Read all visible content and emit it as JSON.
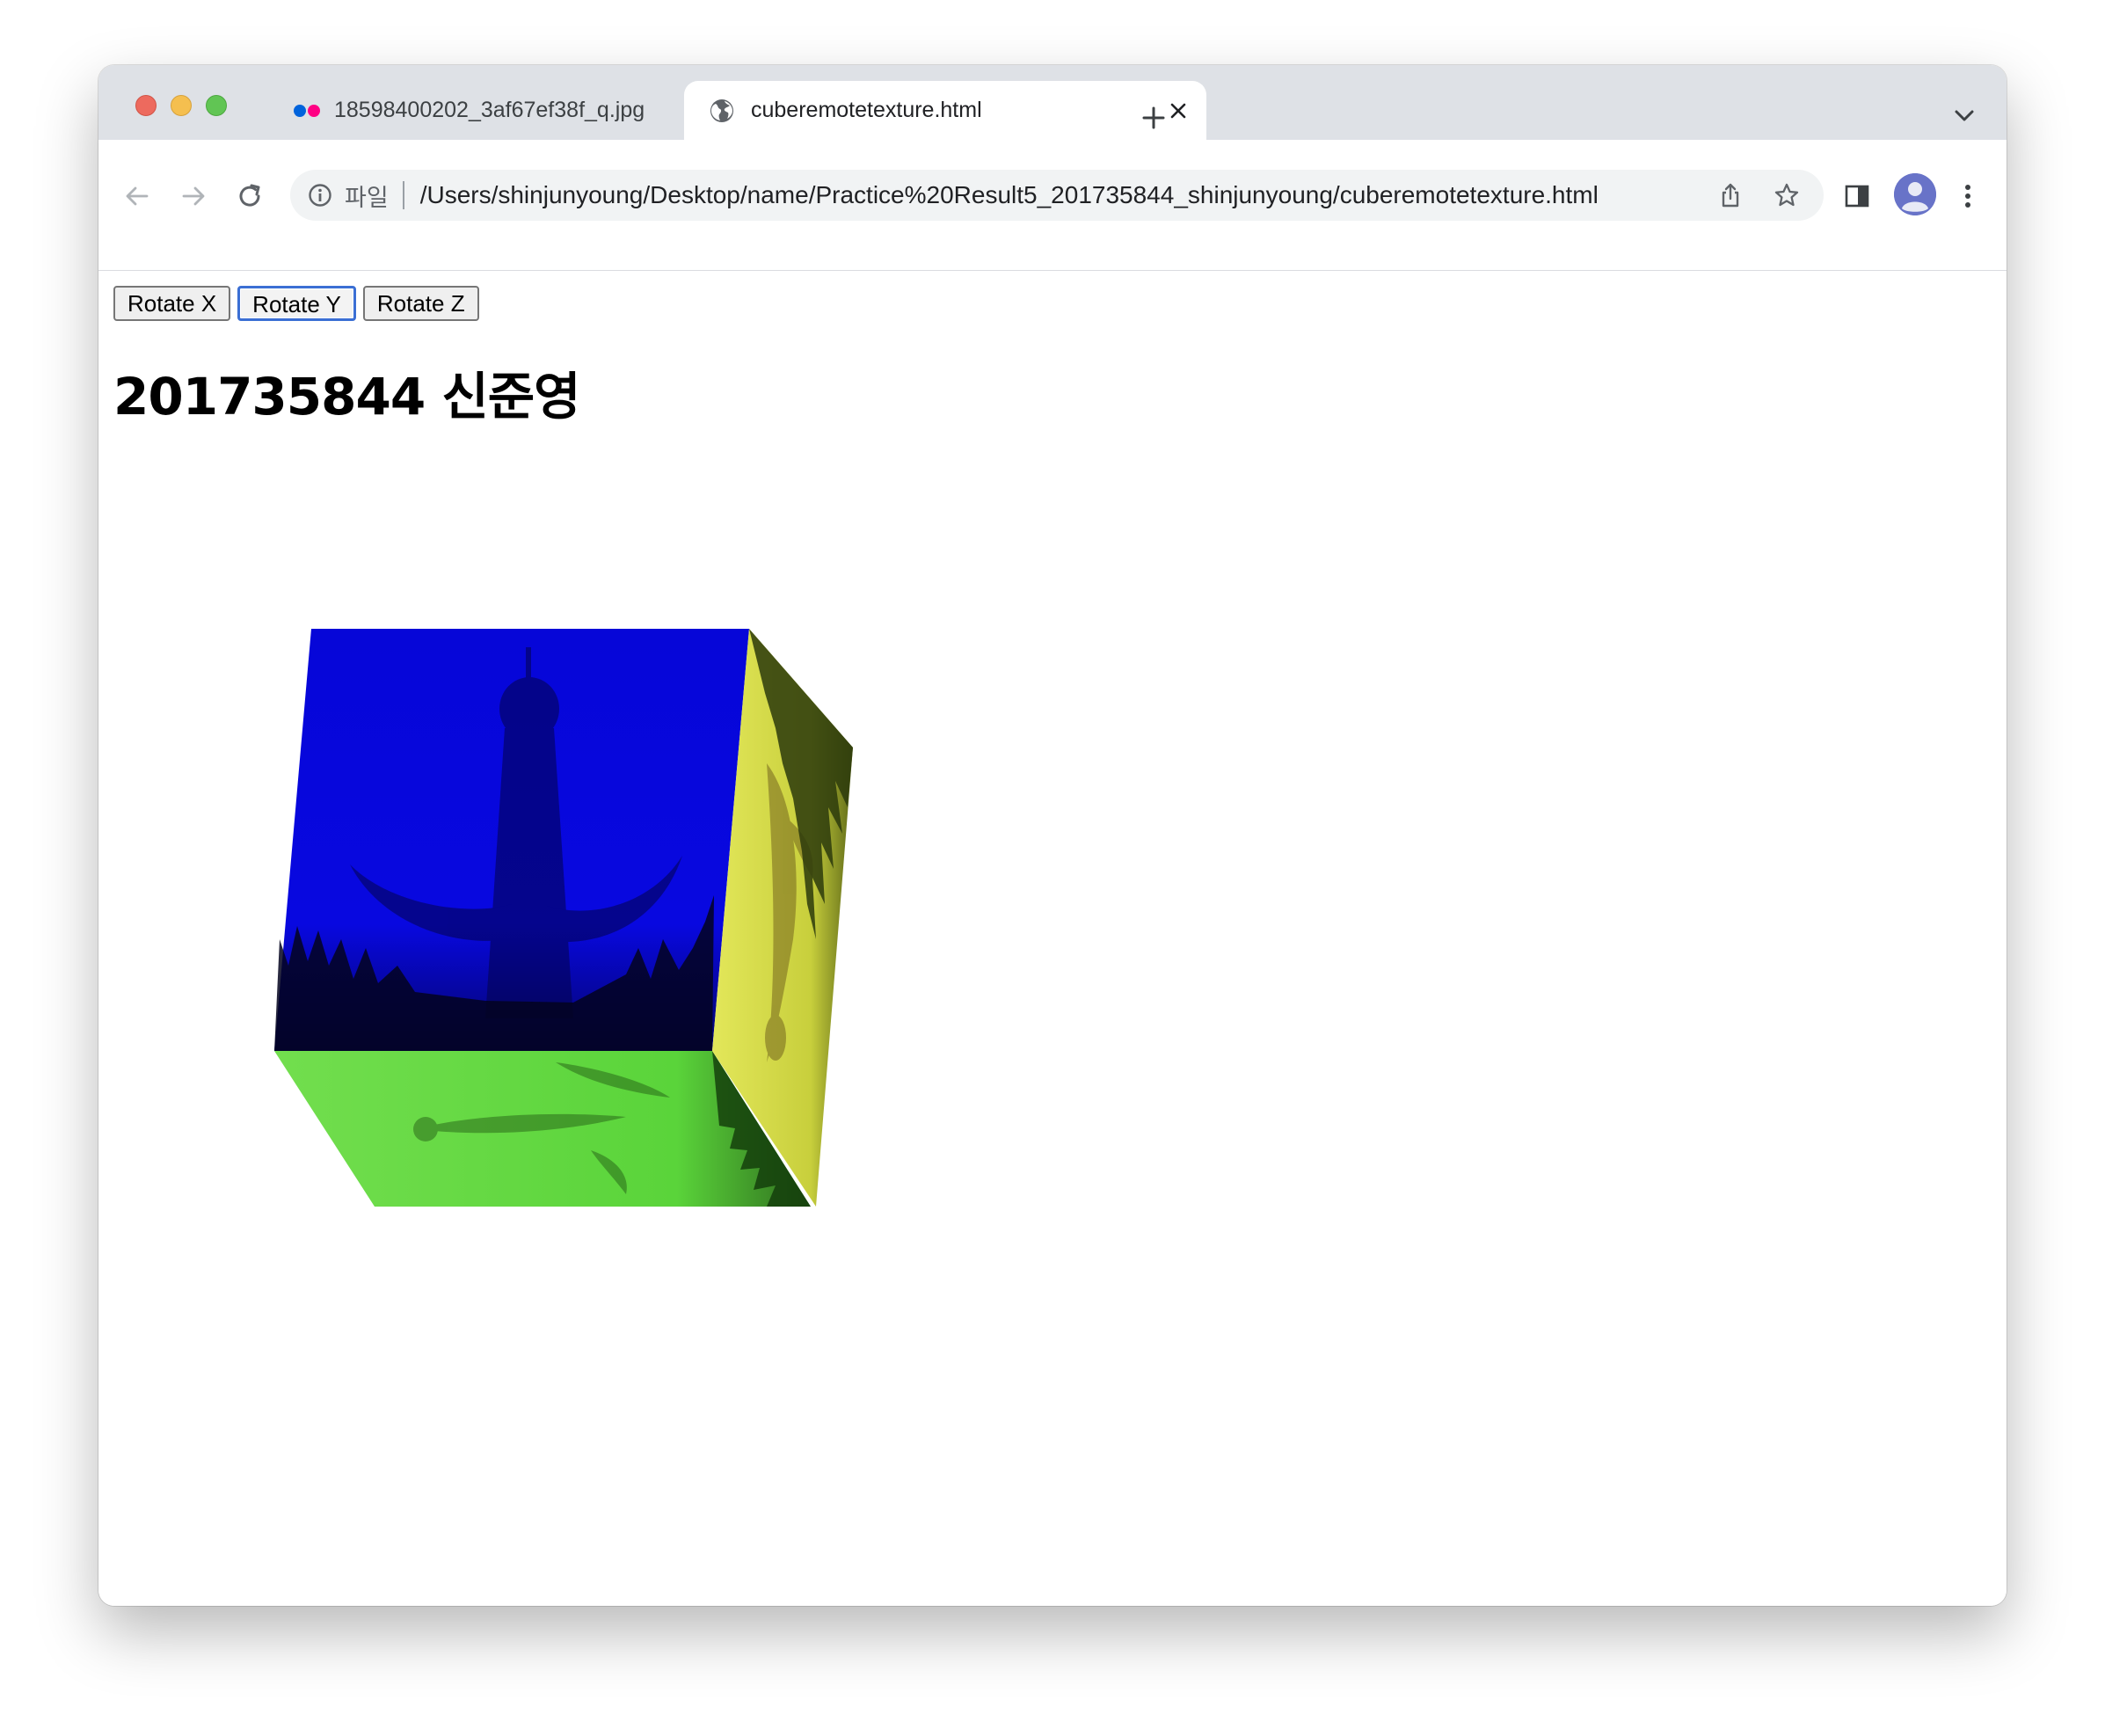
{
  "browser": {
    "tabs": [
      {
        "title": "18598400202_3af67ef38f_q.jpg",
        "icon": "flickr-icon",
        "active": false
      },
      {
        "title": "cuberemotetexture.html",
        "icon": "globe-icon",
        "active": true
      }
    ],
    "address_bar": {
      "scheme_label": "파일",
      "url": "/Users/shinjunyoung/Desktop/name/Practice%20Result5_201735844_shinjunyoung/cuberemotetexture.html"
    }
  },
  "page": {
    "buttons": [
      {
        "label": "Rotate X"
      },
      {
        "label": "Rotate Y",
        "focused": true
      },
      {
        "label": "Rotate Z"
      }
    ],
    "heading": "201735844 신준영"
  },
  "colors": {
    "cube_front": "#0a0ae0",
    "cube_bottom": "#6bd946",
    "cube_side": "#d8e050",
    "focus_ring": "#3b6fd4"
  }
}
